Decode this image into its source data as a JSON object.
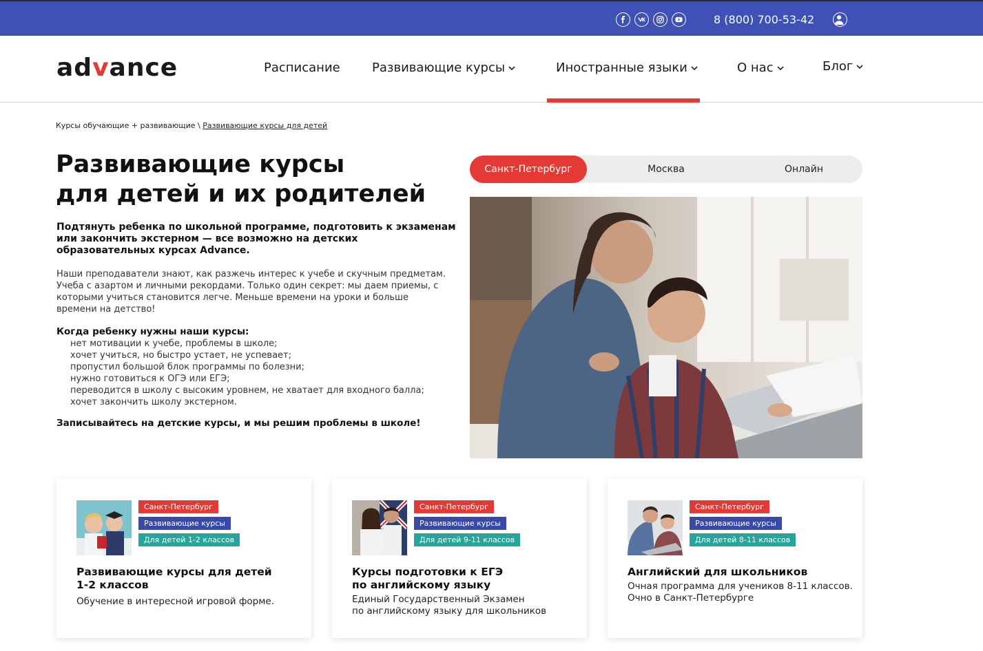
{
  "topbar": {
    "social_icons": [
      "facebook-icon",
      "vk-icon",
      "instagram-icon",
      "youtube-icon"
    ],
    "phone": "8 (800) 700-53-42",
    "bg_color": "#3f51b5"
  },
  "header": {
    "logo_left": "ad",
    "logo_v": "v",
    "logo_right": "ance",
    "accent": "#e53935",
    "nav": [
      {
        "label": "Расписание",
        "has_dropdown": false
      },
      {
        "label": "Развивающие курсы",
        "has_dropdown": true
      },
      {
        "label": "Иностранные языки",
        "has_dropdown": true,
        "active": true
      },
      {
        "label": "О нас",
        "has_dropdown": true
      },
      {
        "label": "Блог",
        "has_dropdown": true
      }
    ]
  },
  "breadcrumb": {
    "root": "Курсы обучающие + развивающие",
    "separator": " \\ ",
    "current": "Развивающие курсы для детей"
  },
  "main": {
    "title_line1": "Развивающие курсы",
    "title_line2": "для детей и их родителей",
    "lead": "Подтянуть ребенка по школьной программе, подготовить к экзаменам или закончить экстерном — все возможно на детских образовательных курсах Advance.",
    "body": "Наши преподаватели знают, как разжечь интерес к учебе и скучным предметам. Учеба с азартом и личными рекордами. Только один секрет: мы даем приемы, с которыми учиться становится легче. Меньше времени на уроки и больше времени на детство!",
    "when_title": "Когда ребенку нужны наши курсы:",
    "when_items": [
      "нет мотивации к учебе, проблемы в школе;",
      "хочет учиться, но быстро устает, не успевает;",
      "пропустил большой блок программы по болезни;",
      "нужно готовиться к ОГЭ или ЕГЭ;",
      "переводится в школу с высоким уровнем, не хватает для входного балла;",
      "хочет закончить школу экстерном."
    ],
    "cta": "Записывайтесь на детские курсы, и мы решим проблемы в школе!"
  },
  "city_switch": {
    "tabs": [
      "Санкт-Петербург",
      "Москва",
      "Онлайн"
    ],
    "active": "Санкт-Петербург"
  },
  "cards": [
    {
      "tags": [
        "Санкт-Петербург",
        "Развивающие курсы",
        "Для детей 1-2 классов"
      ],
      "title_line1": "Развивающие курсы для детей",
      "title_line2": "1-2 классов",
      "desc_line1": "Обучение в интересной игровой форме.",
      "desc_line2": ""
    },
    {
      "tags": [
        "Санкт-Петербург",
        "Развивающие курсы",
        "Для детей 9-11 классов"
      ],
      "title_line1": "Курсы подготовки к ЕГЭ",
      "title_line2": "по английскому языку",
      "desc_line1": "Единый Государственный Экзамен",
      "desc_line2": "по английскому языку для школьников"
    },
    {
      "tags": [
        "Санкт-Петербург",
        "Развивающие курсы",
        "Для детей 8-11 классов"
      ],
      "title_line1": "Английский для школьников",
      "title_line2": "",
      "desc_line1": "Очная программа для учеников 8-11 классов.",
      "desc_line2": "Очно в Санкт-Петербурге"
    }
  ]
}
